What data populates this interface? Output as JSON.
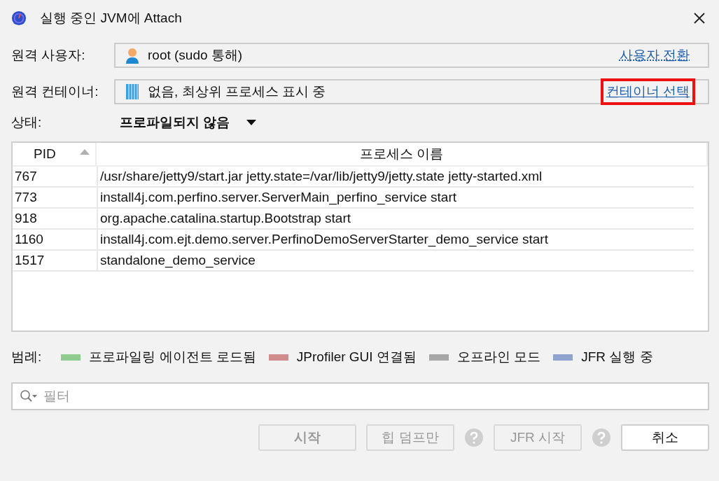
{
  "window": {
    "title": "실행 중인 JVM에 Attach"
  },
  "remote_user": {
    "label": "원격 사용자:",
    "value": "root (sudo 통해)",
    "link": "사용자 전환",
    "highlighted": false
  },
  "remote_container": {
    "label": "원격 컨테이너:",
    "value": "없음, 최상위 프로세스 표시 중",
    "link": "컨테이너 선택",
    "highlighted": true
  },
  "status": {
    "label": "상태:",
    "value": "프로파일되지 않음"
  },
  "table": {
    "columns": [
      {
        "label": "PID",
        "sorted": true
      },
      {
        "label": "프로세스 이름",
        "sorted": false
      }
    ],
    "rows": [
      {
        "pid": "767",
        "name": "/usr/share/jetty9/start.jar jetty.state=/var/lib/jetty9/jetty.state jetty-started.xml"
      },
      {
        "pid": "773",
        "name": "install4j.com.perfino.server.ServerMain_perfino_service start"
      },
      {
        "pid": "918",
        "name": "org.apache.catalina.startup.Bootstrap start"
      },
      {
        "pid": "1160",
        "name": "install4j.com.ejt.demo.server.PerfinoDemoServerStarter_demo_service start"
      },
      {
        "pid": "1517",
        "name": "standalone_demo_service"
      }
    ]
  },
  "legend": {
    "label": "범례:",
    "items": [
      {
        "label": "프로파일링 에이전트 로드됨",
        "color": "#8fcc8f"
      },
      {
        "label": "JProfiler GUI 연결됨",
        "color": "#d08c8c"
      },
      {
        "label": "오프라인 모드",
        "color": "#a6a6a6"
      },
      {
        "label": "JFR 실행 중",
        "color": "#8fa3d0"
      }
    ]
  },
  "filter": {
    "placeholder": "필터"
  },
  "buttons": [
    {
      "kind": "button",
      "label": "시작",
      "disabled": true,
      "bold": true
    },
    {
      "kind": "button",
      "label": "힙 덤프만",
      "disabled": true,
      "bold": false
    },
    {
      "kind": "help",
      "disabled": true
    },
    {
      "kind": "button",
      "label": "JFR 시작",
      "disabled": true,
      "bold": false
    },
    {
      "kind": "help",
      "disabled": true
    },
    {
      "kind": "button",
      "label": "취소",
      "disabled": false,
      "bold": false
    }
  ]
}
